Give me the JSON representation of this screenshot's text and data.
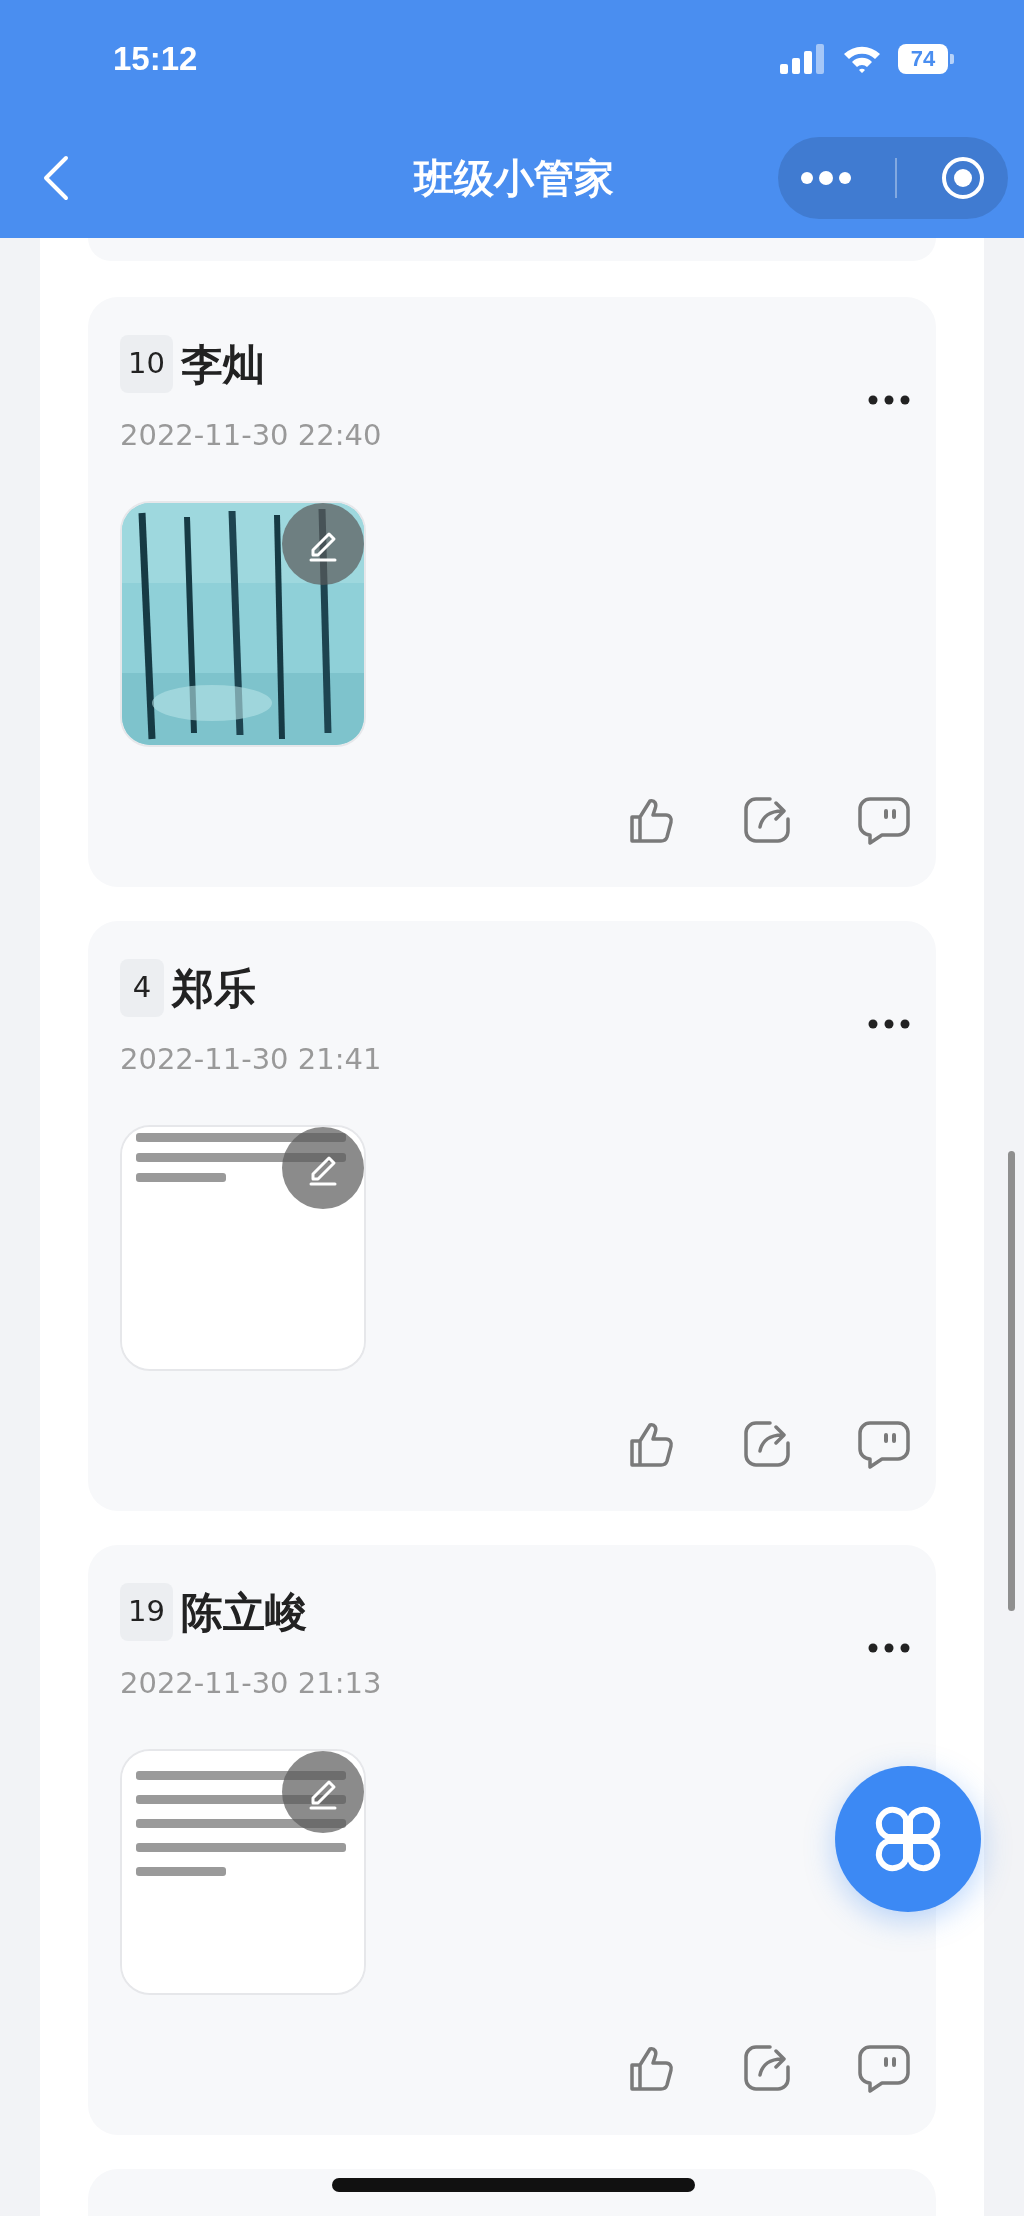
{
  "status_bar": {
    "time": "15:12",
    "battery": "74"
  },
  "nav": {
    "title": "班级小管家"
  },
  "posts": [
    {
      "number": "10",
      "name": "李灿",
      "time": "2022-11-30 22:40"
    },
    {
      "number": "4",
      "name": "郑乐",
      "time": "2022-11-30 21:41"
    },
    {
      "number": "19",
      "name": "陈立峻",
      "time": "2022-11-30 21:13"
    }
  ]
}
